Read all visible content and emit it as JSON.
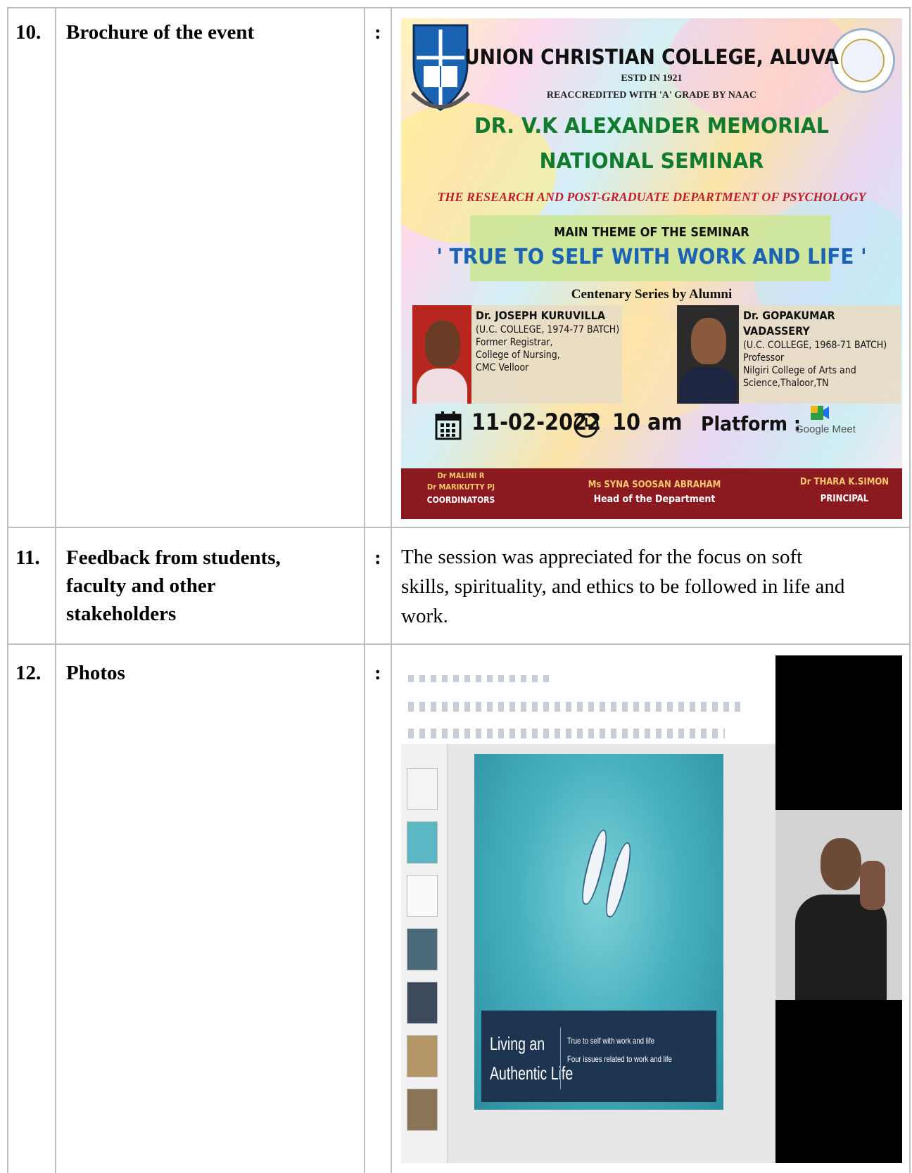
{
  "rows": [
    {
      "number": "10.",
      "label": "Brochure of the event",
      "separator": ":"
    },
    {
      "number": "11.",
      "label": "Feedback from students, faculty and other stakeholders",
      "label_lines": [
        "Feedback from students,",
        "faculty and other",
        "stakeholders"
      ],
      "separator": ":",
      "answer_lines": [
        "The session was appreciated for the focus on soft",
        "skills, spirituality, and ethics to be followed in life and",
        "work."
      ]
    },
    {
      "number": "12.",
      "label": "Photos",
      "separator": ":"
    }
  ],
  "brochure": {
    "college": "UNION CHRISTIAN COLLEGE, ALUVA",
    "estd": "ESTD IN 1921",
    "accreditation": "REACCREDITED WITH 'A' GRADE BY NAAC",
    "title_1": "DR. V.K ALEXANDER MEMORIAL",
    "title_2": "NATIONAL SEMINAR",
    "department": "THE RESEARCH AND POST-GRADUATE DEPARTMENT OF PSYCHOLOGY",
    "theme_heading": "MAIN THEME OF THE SEMINAR",
    "theme": "' TRUE TO SELF WITH WORK AND LIFE '",
    "series": "Centenary Series by Alumni",
    "speaker_1": {
      "name": "Dr. JOSEPH KURUVILLA",
      "batch": "(U.C. COLLEGE, 1974-77 BATCH)",
      "line_1": "Former Registrar,",
      "line_2": "College of Nursing,",
      "line_3": "CMC Velloor"
    },
    "speaker_2": {
      "name": "Dr. GOPAKUMAR VADASSERY",
      "batch": "(U.C. COLLEGE, 1968-71 BATCH)",
      "line_1": "Professor",
      "line_2": "Nilgiri College of Arts and",
      "line_3": "Science,Thaloor,TN"
    },
    "date": "11-02-2022",
    "time": "10 am",
    "platform_label": "Platform :",
    "platform": "Google Meet",
    "coordinator_1": "Dr MALINI R",
    "coordinator_2": "Dr MARIKUTTY PJ",
    "coordinators_role": "COORDINATORS",
    "hod_name": "Ms SYNA SOOSAN ABRAHAM",
    "hod_role": "Head of the Department",
    "principal_name": "Dr THARA K.SIMON",
    "principal_role": "PRINCIPAL"
  },
  "photo": {
    "slide_title_1": "Living an",
    "slide_title_2": "Authentic Life",
    "slide_point_1": "True to self with work and life",
    "slide_point_2": "Four issues related to work and life"
  },
  "colors": {
    "border": "#bfbfbf",
    "footer_band": "#8b1a20",
    "title_green": "#127a2e",
    "theme_blue": "#1d63b5",
    "dept_red": "#c0202e"
  },
  "icons": [
    "calendar-icon",
    "clock-icon",
    "google-meet-icon",
    "college-crest-icon",
    "centenary-seal-icon"
  ]
}
